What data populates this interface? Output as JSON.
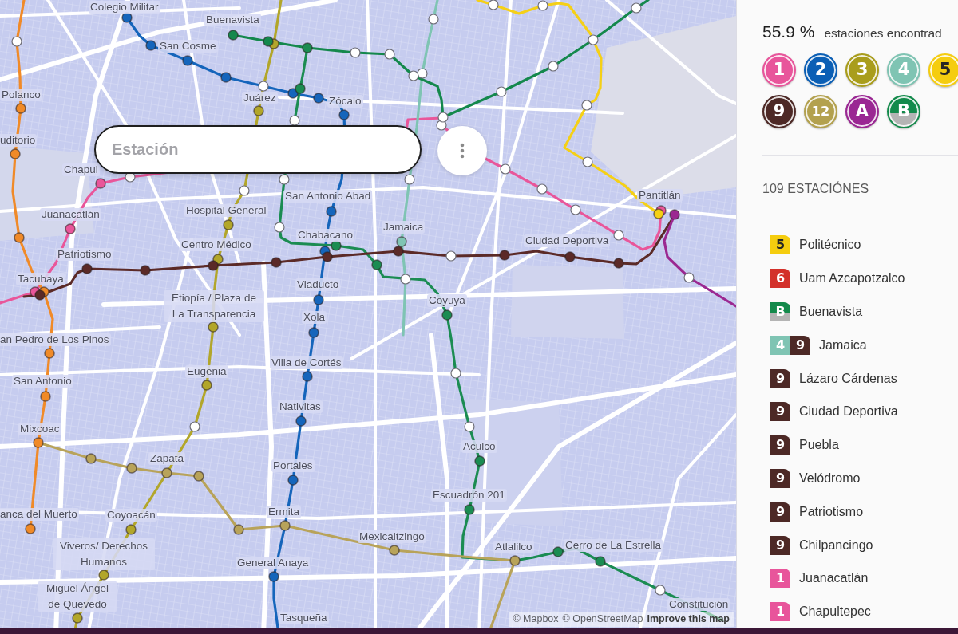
{
  "search": {
    "placeholder": "Estación"
  },
  "map": {
    "lines": [
      {
        "color": "#e9569a",
        "stations": [
          {
            "found": true
          },
          {
            "name": "Juanacatlán",
            "found": true
          },
          {
            "name": "Chapul",
            "found": true
          },
          {
            "found": false
          },
          {
            "found": false
          },
          {
            "found": false
          },
          {
            "found": false
          },
          {
            "found": false
          },
          {
            "found": false
          },
          {
            "name": "Pantitlán",
            "found": true
          }
        ]
      },
      {
        "color": "#1565bb",
        "stations": [
          {
            "name": "Colegio Militar",
            "found": true
          },
          {
            "name": "San Cosme",
            "found": true
          },
          {
            "found": true
          },
          {
            "found": true
          },
          {
            "found": false
          },
          {
            "found": true
          },
          {
            "found": true
          },
          {
            "name": "Zócalo",
            "found": true
          },
          {
            "name": "San Antonio Abad",
            "found": true
          },
          {
            "found": true
          },
          {
            "name": "Viaducto",
            "found": true
          },
          {
            "name": "Xola",
            "found": true
          },
          {
            "name": "Villa de Cortés",
            "found": true
          },
          {
            "name": "Nativitas",
            "found": true
          },
          {
            "name": "Portales",
            "found": true
          },
          {
            "name": "General Anaya",
            "found": true
          },
          {
            "name": "Tasqueña"
          }
        ]
      },
      {
        "color": "#b2a62a",
        "stations": [
          {
            "found": true
          },
          {
            "name": "Juárez",
            "found": true
          },
          {
            "found": false
          },
          {
            "name": "Hospital General",
            "found": true
          },
          {
            "name": "Centro Médico",
            "found": true
          },
          {
            "name": "Etiopía / Plaza de La Transparencia",
            "found": true
          },
          {
            "name": "Eugenia",
            "found": true
          },
          {
            "found": false
          },
          {
            "name": "Coyoacán",
            "found": true
          },
          {
            "name": "Viveros/ Derechos Humanos",
            "found": true
          },
          {
            "name": "Miguel Ángel de Quevedo",
            "found": true
          }
        ]
      },
      {
        "color": "#7fc4b3",
        "stations": [
          {
            "found": false
          },
          {
            "found": false
          },
          {
            "found": false
          },
          {
            "name": "Jamaica",
            "found": true
          },
          {
            "found": false
          }
        ]
      },
      {
        "color": "#f5d016",
        "stations": [
          {
            "found": false
          },
          {
            "found": false
          },
          {
            "found": false
          },
          {
            "found": false
          },
          {
            "found": false
          },
          {
            "found": true
          }
        ]
      },
      {
        "color": "#f08a28",
        "stations": [
          {
            "found": false
          },
          {
            "name": "Polanco",
            "found": true
          },
          {
            "name": "uditorio",
            "found": true
          },
          {
            "found": true
          },
          {
            "name": "Tacubaya",
            "found": true
          },
          {
            "name": "an Pedro de Los Pinos",
            "found": true
          },
          {
            "name": "San Antonio",
            "found": true
          },
          {
            "name": "Mixcoac",
            "found": true
          },
          {
            "name": "anca del Muerto",
            "found": true
          }
        ]
      },
      {
        "color": "#1b8c52",
        "stations": [
          {
            "found": true
          },
          {
            "found": true
          },
          {
            "found": false
          },
          {
            "found": false
          },
          {
            "found": false
          },
          {
            "name": "Chabacano",
            "found": true
          },
          {
            "found": true
          },
          {
            "name": "Coyuya",
            "found": true
          },
          {
            "found": false
          },
          {
            "found": false
          },
          {
            "name": "Aculco",
            "found": true
          },
          {
            "name": "Escuadrón 201",
            "found": true
          },
          {
            "found": true
          },
          {
            "name": "Cerro de La Estrella",
            "found": true
          },
          {
            "found": false
          },
          {
            "name": "Constitución"
          }
        ]
      },
      {
        "color": "#5b2a27",
        "stations": [
          {
            "found": true
          },
          {
            "name": "Patriotismo",
            "found": true
          },
          {
            "found": true
          },
          {
            "found": true
          },
          {
            "found": true
          },
          {
            "found": true
          },
          {
            "found": true
          },
          {
            "found": false
          },
          {
            "found": true
          },
          {
            "name": "Ciudad Deportiva",
            "found": true
          },
          {
            "found": true
          }
        ]
      },
      {
        "color": "#b8a35a",
        "stations": [
          {
            "found": true
          },
          {
            "found": true
          },
          {
            "name": "Zapata",
            "found": true
          },
          {
            "found": true
          },
          {
            "found": true
          },
          {
            "name": "Ermita",
            "found": true
          },
          {
            "name": "Mexicaltzingo",
            "found": true
          },
          {
            "name": "Atlalilco",
            "found": true
          }
        ]
      },
      {
        "color": "#9b2891",
        "stations": [
          {
            "found": true
          },
          {
            "found": false
          }
        ]
      },
      {
        "color": "#14884c",
        "stations": [
          {
            "name": "Buenavista",
            "found": true
          },
          {
            "found": true
          },
          {
            "found": false
          },
          {
            "found": false
          },
          {
            "found": false
          },
          {
            "found": false
          },
          {
            "found": false
          },
          {
            "found": false
          },
          {
            "found": false
          }
        ]
      }
    ],
    "attribution": [
      "© Mapbox",
      "© OpenStreetMap",
      "Improve this map"
    ]
  },
  "sidebar": {
    "progress": "55.9 %",
    "progress_label": "estaciones encontrad",
    "line_badge_rows": [
      [
        {
          "label": "1",
          "color": "#e8559b",
          "kind": "solid"
        },
        {
          "label": "2",
          "color": "#0b5fb5",
          "kind": "solid"
        },
        {
          "label": "3",
          "color": "#a99d1c",
          "kind": "solid"
        },
        {
          "label": "4",
          "color": "#7fc4b3",
          "kind": "solid"
        },
        {
          "label": "5",
          "color": "#f5cd0f",
          "kind": "solid"
        }
      ],
      [
        {
          "label": "9",
          "color": "#4d2926",
          "kind": "solid"
        },
        {
          "label": "12",
          "color": "#b3a14e",
          "kind": "solid"
        },
        {
          "label": "A",
          "color": "#9a2693",
          "kind": "solid"
        },
        {
          "label": "B",
          "color": "#138a4b",
          "kind": "split"
        }
      ]
    ],
    "station_count": "109 ESTACIÓNES",
    "found_stations": [
      {
        "lines": [
          {
            "label": "5",
            "color": "#f5cd0f",
            "kind": "solid"
          }
        ],
        "name": "Politécnico"
      },
      {
        "lines": [
          {
            "label": "6",
            "color": "#d3302a",
            "kind": "solid"
          }
        ],
        "name": "Uam Azcapotzalco"
      },
      {
        "lines": [
          {
            "label": "B",
            "color": "#138a4b",
            "kind": "split"
          }
        ],
        "name": "Buenavista"
      },
      {
        "lines": [
          {
            "label": "4",
            "color": "#7fc4b3",
            "kind": "solid"
          },
          {
            "label": "9",
            "color": "#4d2926",
            "kind": "solid"
          }
        ],
        "name": "Jamaica"
      },
      {
        "lines": [
          {
            "label": "9",
            "color": "#4d2926",
            "kind": "solid"
          }
        ],
        "name": "Lázaro Cárdenas"
      },
      {
        "lines": [
          {
            "label": "9",
            "color": "#4d2926",
            "kind": "solid"
          }
        ],
        "name": "Ciudad Deportiva"
      },
      {
        "lines": [
          {
            "label": "9",
            "color": "#4d2926",
            "kind": "solid"
          }
        ],
        "name": "Puebla"
      },
      {
        "lines": [
          {
            "label": "9",
            "color": "#4d2926",
            "kind": "solid"
          }
        ],
        "name": "Velódromo"
      },
      {
        "lines": [
          {
            "label": "9",
            "color": "#4d2926",
            "kind": "solid"
          }
        ],
        "name": "Patriotismo"
      },
      {
        "lines": [
          {
            "label": "9",
            "color": "#4d2926",
            "kind": "solid"
          }
        ],
        "name": "Chilpancingo"
      },
      {
        "lines": [
          {
            "label": "1",
            "color": "#e8559b",
            "kind": "solid"
          }
        ],
        "name": "Juanacatlán"
      },
      {
        "lines": [
          {
            "label": "1",
            "color": "#e8559b",
            "kind": "solid"
          }
        ],
        "name": "Chapultepec"
      }
    ]
  }
}
